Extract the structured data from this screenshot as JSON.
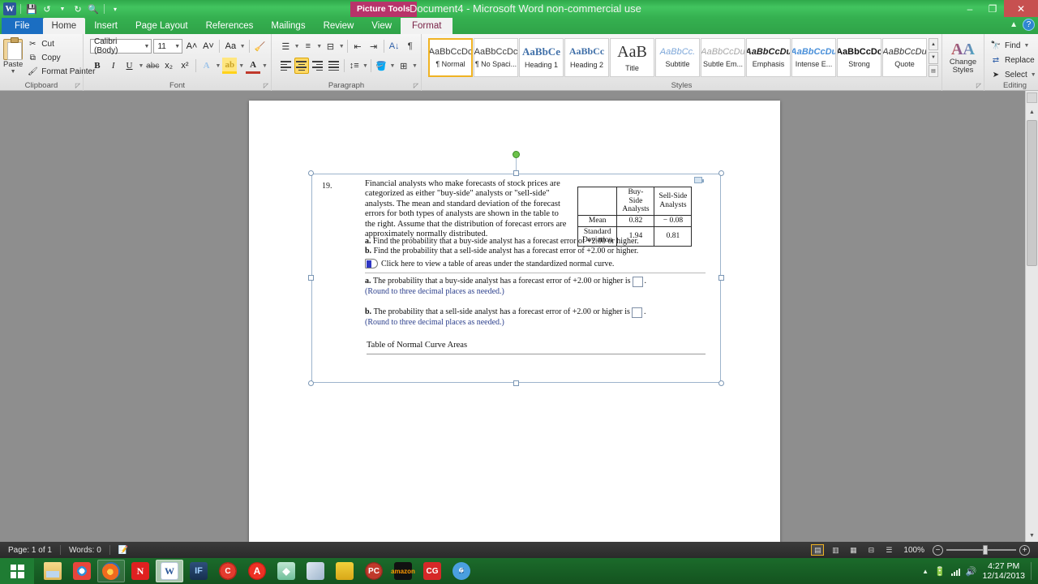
{
  "titlebar": {
    "quick_access": [
      "word-logo",
      "save-icon",
      "undo-icon",
      "redo-icon",
      "print-preview-icon",
      "customize-qat-icon"
    ],
    "context_tab_group": "Picture Tools",
    "document_title": "Document4  -  Microsoft Word non-commercial use",
    "window_controls": {
      "minimize": "–",
      "restore": "❐",
      "close": "✕"
    }
  },
  "tabs": [
    {
      "label": "File",
      "type": "file"
    },
    {
      "label": "Home",
      "type": "active"
    },
    {
      "label": "Insert",
      "type": "normal"
    },
    {
      "label": "Page Layout",
      "type": "normal"
    },
    {
      "label": "References",
      "type": "normal"
    },
    {
      "label": "Mailings",
      "type": "normal"
    },
    {
      "label": "Review",
      "type": "normal"
    },
    {
      "label": "View",
      "type": "normal"
    },
    {
      "label": "Format",
      "type": "context"
    }
  ],
  "ribbon": {
    "clipboard": {
      "group_label": "Clipboard",
      "paste_label": "Paste",
      "commands": [
        {
          "label": "Cut",
          "icon": "scissors-icon"
        },
        {
          "label": "Copy",
          "icon": "copy-icon"
        },
        {
          "label": "Format Painter",
          "icon": "format-painter-icon"
        }
      ]
    },
    "font": {
      "group_label": "Font",
      "font_name": "Calibri (Body)",
      "font_size": "11",
      "buttons_row1": [
        "grow-font-icon",
        "shrink-font-icon",
        "change-case-icon",
        "clear-formatting-icon"
      ],
      "buttons_row2": [
        "bold-icon",
        "italic-icon",
        "underline-icon",
        "strikethrough-icon",
        "subscript-icon",
        "superscript-icon",
        "text-effects-icon",
        "text-highlight-icon",
        "font-color-icon"
      ]
    },
    "paragraph": {
      "group_label": "Paragraph",
      "buttons_row1": [
        "bullets-icon",
        "numbering-icon",
        "multilevel-list-icon",
        "decrease-indent-icon",
        "increase-indent-icon",
        "sort-icon",
        "show-marks-icon"
      ],
      "buttons_row2": [
        "align-left-icon",
        "align-center-icon",
        "align-right-icon",
        "justify-icon",
        "line-spacing-icon",
        "shading-icon",
        "borders-icon"
      ],
      "active_button": "align-center-icon"
    },
    "styles": {
      "group_label": "Styles",
      "items": [
        {
          "preview": "AaBbCcDc",
          "name": "¶ Normal",
          "selected": true
        },
        {
          "preview": "AaBbCcDc",
          "name": "¶ No Spaci...",
          "selected": false
        },
        {
          "preview": "AaBbCе",
          "name": "Heading 1",
          "selected": false
        },
        {
          "preview": "AaBbCc",
          "name": "Heading 2",
          "selected": false
        },
        {
          "preview": "AaB",
          "name": "Title",
          "selected": false
        },
        {
          "preview": "AaBbCc.",
          "name": "Subtitle",
          "selected": false
        },
        {
          "preview": "AaBbCcDu",
          "name": "Subtle Em...",
          "selected": false
        },
        {
          "preview": "AaBbCcDu",
          "name": "Emphasis",
          "selected": false
        },
        {
          "preview": "AaBbCcDu",
          "name": "Intense E...",
          "selected": false
        },
        {
          "preview": "AaBbCcDc",
          "name": "Strong",
          "selected": false
        },
        {
          "preview": "AaBbCcDu",
          "name": "Quote",
          "selected": false
        }
      ]
    },
    "change_styles": {
      "label_line1": "Change",
      "label_line2": "Styles"
    },
    "editing": {
      "group_label": "Editing",
      "commands": [
        {
          "label": "Find",
          "icon": "binoculars-icon",
          "has_caret": true
        },
        {
          "label": "Replace",
          "icon": "replace-icon",
          "has_caret": false
        },
        {
          "label": "Select",
          "icon": "select-icon",
          "has_caret": true
        }
      ]
    }
  },
  "document": {
    "question_number": "19.",
    "question_text": "Financial analysts who make forecasts of stock prices are categorized as either \"buy-side\" analysts or \"sell-side\" analysts. The mean and standard deviation of the forecast errors for both types of analysts are shown in the table to the right. Assume that the distribution of forecast errors are approximately normally distributed.",
    "table": {
      "column_headers": [
        "",
        "Buy-Side Analysts",
        "Sell-Side Analysts"
      ],
      "rows": [
        {
          "label": "Mean",
          "buy_side": "0.82",
          "sell_side": "− 0.08"
        },
        {
          "label": "Standard Deviation",
          "buy_side": "1.94",
          "sell_side": "0.81"
        }
      ]
    },
    "parts": [
      {
        "marker": "a.",
        "text": "Find the probability that a buy-side analyst has a forecast error of +2.00 or higher."
      },
      {
        "marker": "b.",
        "text": "Find the probability that a sell-side analyst has a forecast error of +2.00 or higher."
      }
    ],
    "link_line": "Click here to view a table of areas under the standardized normal curve.",
    "answers": [
      {
        "marker": "a.",
        "prompt": "The probability that a buy-side analyst has a forecast error of +2.00 or higher is",
        "value": "",
        "note": "(Round to three decimal places as needed.)"
      },
      {
        "marker": "b.",
        "prompt": "The probability that a sell-side analyst has a forecast error of +2.00 or higher is",
        "value": "",
        "note": "(Round to three decimal places as needed.)"
      }
    ],
    "footer_heading": "Table of Normal Curve Areas"
  },
  "statusbar": {
    "page": "Page: 1 of 1",
    "words": "Words: 0",
    "proofing_icon": "proofing-errors-icon",
    "view_buttons": [
      "print-layout-icon",
      "full-screen-reading-icon",
      "web-layout-icon",
      "outline-icon",
      "draft-icon"
    ],
    "active_view": "print-layout-icon",
    "zoom": "100%"
  },
  "taskbar": {
    "start": "start-button",
    "items": [
      {
        "name": "file-explorer",
        "glyph": "",
        "kind": "folder",
        "state": "pinned"
      },
      {
        "name": "google-chrome",
        "glyph": "",
        "kind": "chrome",
        "state": "pinned"
      },
      {
        "name": "mozilla-firefox",
        "glyph": "",
        "kind": "firefox",
        "state": "running"
      },
      {
        "name": "netflix",
        "glyph": "N",
        "kind": "n",
        "state": "pinned"
      },
      {
        "name": "microsoft-word",
        "glyph": "W",
        "kind": "word",
        "state": "active"
      },
      {
        "name": "irfanview",
        "glyph": "IF",
        "kind": "if",
        "state": "pinned"
      },
      {
        "name": "ccleaner",
        "glyph": "C",
        "kind": "cc",
        "state": "pinned"
      },
      {
        "name": "avast-antivirus",
        "glyph": "A",
        "kind": "avast",
        "state": "pinned"
      },
      {
        "name": "the-sims",
        "glyph": "◆",
        "kind": "sims",
        "state": "pinned"
      },
      {
        "name": "media-player",
        "glyph": "",
        "kind": "media",
        "state": "pinned"
      },
      {
        "name": "notes-app",
        "glyph": "",
        "kind": "yellow",
        "state": "pinned"
      },
      {
        "name": "pc-app",
        "glyph": "PC",
        "kind": "pc",
        "state": "pinned"
      },
      {
        "name": "amazon",
        "glyph": "amazon",
        "kind": "amazon",
        "state": "pinned"
      },
      {
        "name": "cg-app",
        "glyph": "CG",
        "kind": "cg",
        "state": "pinned"
      },
      {
        "name": "itunes",
        "glyph": "♫",
        "kind": "itunes",
        "state": "pinned"
      }
    ],
    "tray": {
      "show_hidden": "▲",
      "battery": "battery-icon",
      "network": "network-icon",
      "volume": "volume-icon"
    },
    "clock": {
      "time": "4:27 PM",
      "date": "12/14/2013"
    }
  }
}
